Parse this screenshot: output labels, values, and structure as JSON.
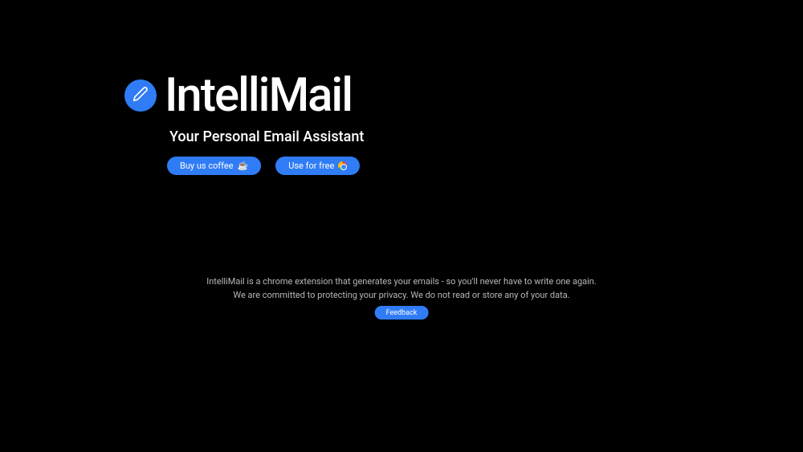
{
  "brand": "IntelliMail",
  "tagline": "Your Personal Email Assistant",
  "buttons": {
    "coffee": "Buy us coffee",
    "coffee_emoji": "☕",
    "use_free": "Use for free"
  },
  "footer": {
    "line1": "IntelliMail is a chrome extension that generates your emails - so you'll never have to write one again.",
    "line2": "We are committed to protecting your privacy. We do not read or store any of your data."
  },
  "feedback": "Feedback"
}
